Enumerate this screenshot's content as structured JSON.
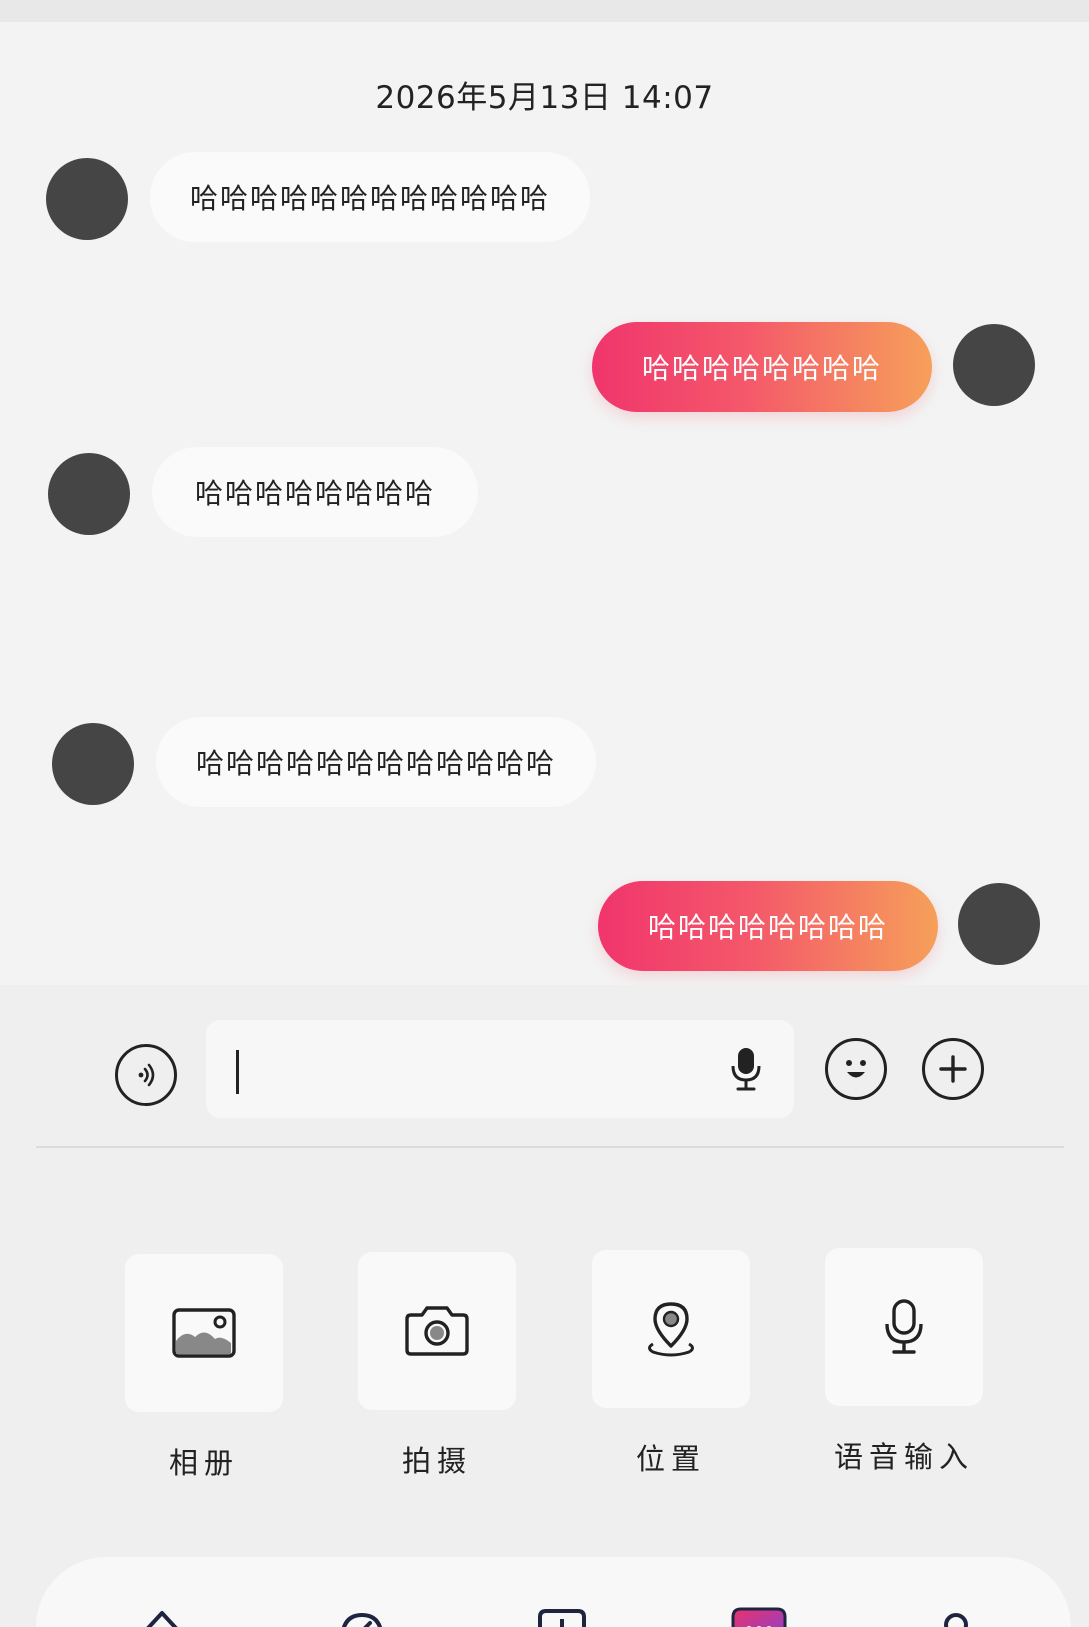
{
  "chat": {
    "timestamp": "2026年5月13日 14:07",
    "messages": [
      {
        "direction": "incoming",
        "text": "哈哈哈哈哈哈哈哈哈哈哈哈"
      },
      {
        "direction": "outgoing",
        "text": "哈哈哈哈哈哈哈哈"
      },
      {
        "direction": "incoming",
        "text": "哈哈哈哈哈哈哈哈"
      },
      {
        "direction": "incoming",
        "text": "哈哈哈哈哈哈哈哈哈哈哈哈"
      },
      {
        "direction": "outgoing",
        "text": "哈哈哈哈哈哈哈哈"
      }
    ]
  },
  "composer": {
    "input_value": "",
    "voice_toggle_icon": "voice-wave-icon",
    "mic_icon": "microphone-icon",
    "emoji_icon": "smiley-icon",
    "plus_icon": "plus-circle-icon"
  },
  "tools": [
    {
      "label": "相册",
      "icon": "photo-album-icon"
    },
    {
      "label": "拍摄",
      "icon": "camera-icon"
    },
    {
      "label": "位置",
      "icon": "location-pin-icon"
    },
    {
      "label": "语音输入",
      "icon": "microphone-icon"
    }
  ],
  "bottom_nav": {
    "items": [
      {
        "icon": "home-icon"
      },
      {
        "icon": "compass-icon"
      },
      {
        "icon": "add-box-icon"
      },
      {
        "icon": "message-icon",
        "active": true
      },
      {
        "icon": "profile-icon"
      }
    ]
  },
  "colors": {
    "outgoing_gradient_start": "#f0356c",
    "outgoing_gradient_end": "#f6a05a",
    "incoming_bubble": "#fafafa",
    "avatar": "#454545",
    "background": "#f3f3f3"
  }
}
